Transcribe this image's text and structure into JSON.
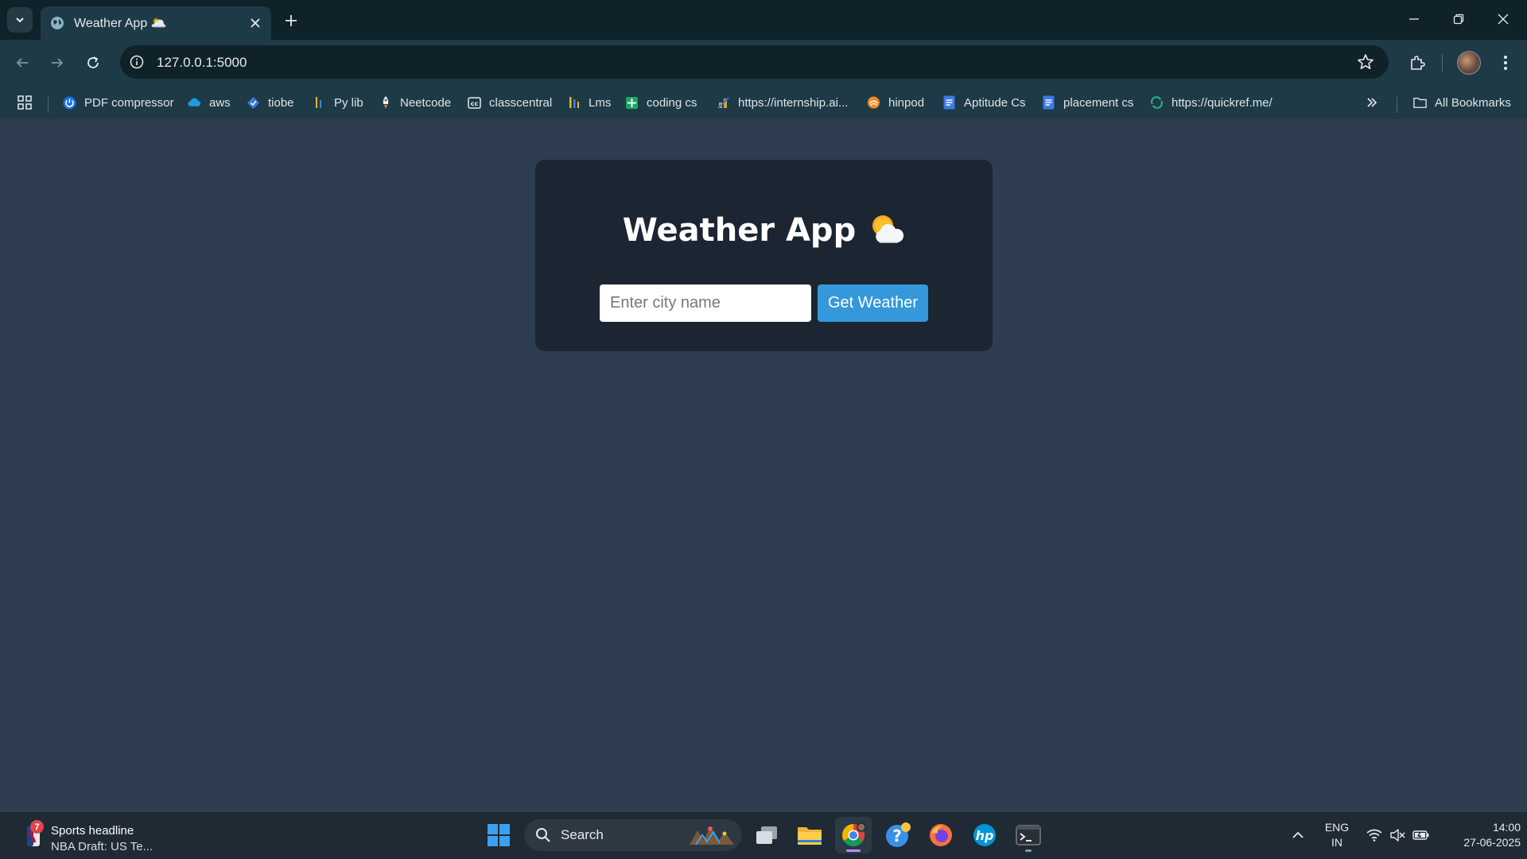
{
  "browser": {
    "tab": {
      "title": "Weather App 🌥️"
    },
    "address_bar": {
      "url": "127.0.0.1:5000"
    },
    "bookmarks": [
      {
        "label": "PDF compressor",
        "icon": "pdf-compressor-icon"
      },
      {
        "label": "aws",
        "icon": "cloud-icon"
      },
      {
        "label": "tiobe",
        "icon": "tiobe-icon"
      },
      {
        "label": "Py lib",
        "icon": "pylib-icon"
      },
      {
        "label": "Neetcode",
        "icon": "rocket-icon"
      },
      {
        "label": "classcentral",
        "icon": "classcentral-icon"
      },
      {
        "label": "Lms",
        "icon": "lms-icon"
      },
      {
        "label": "coding cs",
        "icon": "sheets-icon"
      },
      {
        "label": "https://internship.ai...",
        "icon": "internship-icon"
      },
      {
        "label": "hinpod",
        "icon": "hinpod-icon"
      },
      {
        "label": "Aptitude Cs",
        "icon": "docs-icon"
      },
      {
        "label": "placement cs",
        "icon": "docs-icon"
      },
      {
        "label": "https://quickref.me/",
        "icon": "quickref-icon"
      }
    ],
    "all_bookmarks_label": "All Bookmarks"
  },
  "page": {
    "title": "Weather App",
    "title_emoji": "sun-behind-cloud-icon",
    "city_input": {
      "placeholder": "Enter city name",
      "value": ""
    },
    "get_weather_label": "Get Weather"
  },
  "taskbar": {
    "news": {
      "badge": "7",
      "headline": "Sports headline",
      "subtext": "NBA Draft: US Te..."
    },
    "search_label": "Search",
    "language": {
      "line1": "ENG",
      "line2": "IN"
    },
    "clock": {
      "time": "14:00",
      "date": "27-06-2025"
    }
  },
  "colors": {
    "page_background": "#2e3d50",
    "card_background": "#1c2532",
    "button_blue": "#3498db",
    "browser_frame": "#1e3a46"
  }
}
